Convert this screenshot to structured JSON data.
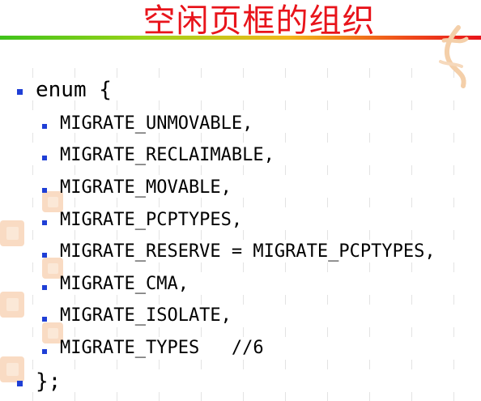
{
  "slide": {
    "title": "空闲页框的组织",
    "opening": "enum {",
    "items": [
      "MIGRATE_UNMOVABLE,",
      "MIGRATE_RECLAIMABLE,",
      "MIGRATE_MOVABLE,",
      "MIGRATE_PCPTYPES,",
      "MIGRATE_RESERVE = MIGRATE_PCPTYPES,",
      "MIGRATE_CMA,",
      "MIGRATE_ISOLATE,",
      "MIGRATE_TYPES   //6"
    ],
    "closing": "};"
  },
  "colors": {
    "title": "#e8141b",
    "bullet": "#1f3fd6",
    "rule_start": "#3ec21a",
    "rule_end": "#e8141b"
  }
}
